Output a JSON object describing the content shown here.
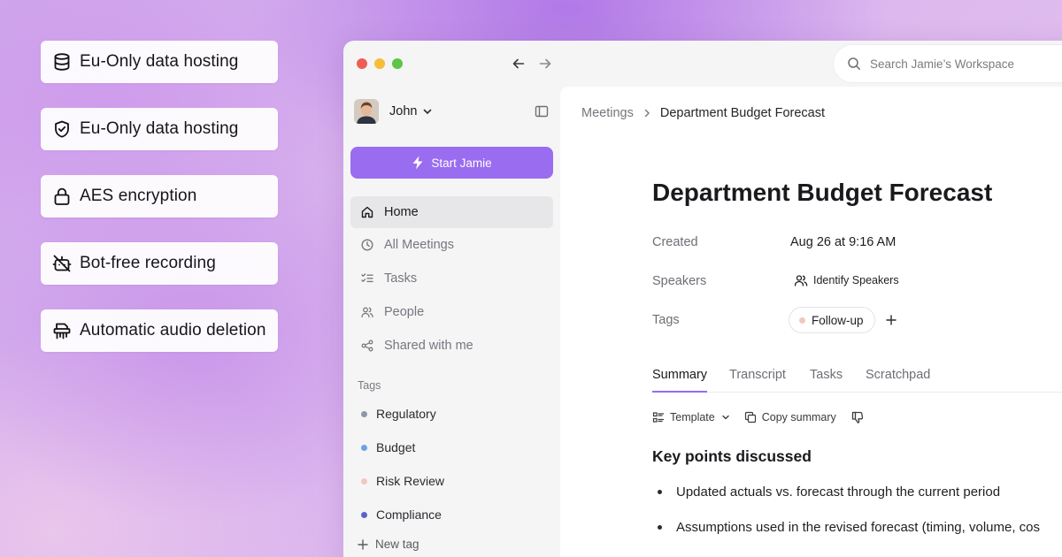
{
  "features": [
    {
      "icon": "database-icon",
      "label": "Eu-Only data hosting"
    },
    {
      "icon": "shield-check-icon",
      "label": "Eu-Only data hosting"
    },
    {
      "icon": "lock-icon",
      "label": "AES encryption"
    },
    {
      "icon": "bot-off-icon",
      "label": "Bot-free recording"
    },
    {
      "icon": "shredder-icon",
      "label": "Automatic audio deletion"
    }
  ],
  "window": {
    "search_placeholder": "Search Jamie’s Workspace"
  },
  "sidebar": {
    "user_name": "John",
    "start_button": "Start Jamie",
    "nav": [
      {
        "icon": "home-icon",
        "label": "Home",
        "active": true
      },
      {
        "icon": "clock-icon",
        "label": "All Meetings"
      },
      {
        "icon": "checklist-icon",
        "label": "Tasks"
      },
      {
        "icon": "people-icon",
        "label": "People"
      },
      {
        "icon": "share-icon",
        "label": "Shared with me"
      }
    ],
    "tags_title": "Tags",
    "tags": [
      {
        "label": "Regulatory",
        "color": "#8f96a8"
      },
      {
        "label": "Budget",
        "color": "#6aa3e6"
      },
      {
        "label": "Risk Review",
        "color": "#f3c6c0"
      },
      {
        "label": "Compliance",
        "color": "#5a63c9"
      }
    ],
    "new_tag": "New tag"
  },
  "main": {
    "breadcrumb": [
      "Meetings",
      "Department Budget Forecast"
    ],
    "title": "Department Budget Forecast",
    "meta": {
      "created_label": "Created",
      "created_value": "Aug 26 at 9:16 AM",
      "speakers_label": "Speakers",
      "speakers_action": "Identify Speakers",
      "tags_label": "Tags",
      "tag_chip": "Follow-up"
    },
    "tabs": [
      "Summary",
      "Transcript",
      "Tasks",
      "Scratchpad"
    ],
    "active_tab": "Summary",
    "toolbar": {
      "template": "Template",
      "copy": "Copy summary"
    },
    "section_title": "Key points discussed",
    "bullets": [
      "Updated actuals vs. forecast through the current period",
      "Assumptions used in the revised forecast (timing, volume, cos"
    ]
  },
  "colors": {
    "accent": "#9a6cf0",
    "traffic_red": "#ee5e55",
    "traffic_yellow": "#f4bd3c",
    "traffic_green": "#5ec447"
  }
}
